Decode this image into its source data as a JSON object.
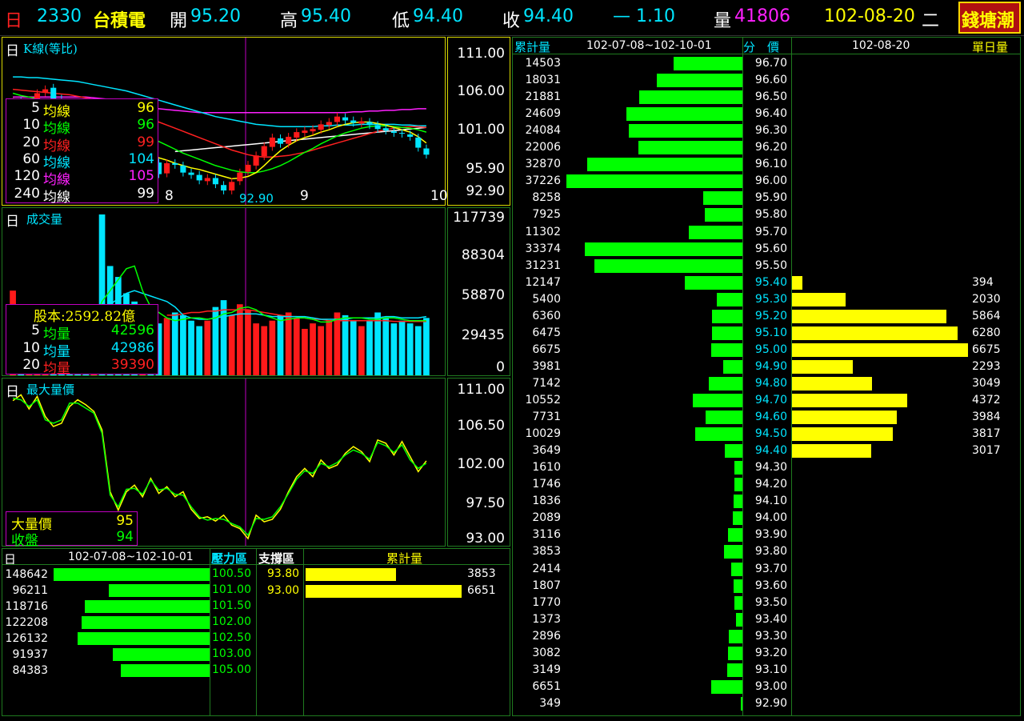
{
  "header": {
    "period": "日",
    "code": "2330",
    "name": "台積電",
    "open_label": "開",
    "open": "95.20",
    "high_label": "高",
    "high": "95.40",
    "low_label": "低",
    "low": "94.40",
    "close_label": "收",
    "close": "94.40",
    "change": "— 1.10",
    "volume_label": "量",
    "volume": "41806",
    "date": "102-08-20",
    "weekday": "二",
    "brand": "錢塘潮"
  },
  "kline": {
    "title_prefix": "日",
    "title": "K線(等比)",
    "axis": [
      "111.00",
      "106.00",
      "101.00",
      "95.90",
      "92.90"
    ],
    "month_labels": [
      "8",
      "9",
      "10"
    ],
    "low_marker": "92.90",
    "ma": [
      {
        "n": "5",
        "label": "均線",
        "value": "96",
        "color": "#ffff00"
      },
      {
        "n": "10",
        "label": "均線",
        "value": "96",
        "color": "#00ff00"
      },
      {
        "n": "20",
        "label": "均線",
        "value": "99",
        "color": "#ff2020"
      },
      {
        "n": "60",
        "label": "均線",
        "value": "104",
        "color": "#00e5ff"
      },
      {
        "n": "120",
        "label": "均線",
        "value": "105",
        "color": "#ff20ff"
      },
      {
        "n": "240",
        "label": "均線",
        "value": "99",
        "color": "#ffffff"
      }
    ]
  },
  "volume_panel": {
    "title_prefix": "日",
    "title": "成交量",
    "axis": [
      "117739",
      "88304",
      "58870",
      "29435",
      "0"
    ],
    "capital": "股本:2592.82億",
    "ma": [
      {
        "n": "5",
        "label": "均量",
        "value": "42596",
        "color": "#00ff00"
      },
      {
        "n": "10",
        "label": "均量",
        "value": "42986",
        "color": "#00e5ff"
      },
      {
        "n": "20",
        "label": "均量",
        "value": "39390",
        "color": "#ff2020"
      }
    ]
  },
  "maxvol_panel": {
    "title_prefix": "日",
    "title": "最大量價",
    "axis": [
      "111.00",
      "106.50",
      "102.00",
      "97.50",
      "93.00"
    ],
    "legend": [
      {
        "label": "大量價",
        "value": "95",
        "color": "#ffff00"
      },
      {
        "label": "收盤",
        "value": "94",
        "color": "#00ff00"
      }
    ]
  },
  "pressure": {
    "title_prefix": "日",
    "range": "102-07-08~102-10-01",
    "pressure_label": "壓力區",
    "support_label": "支撐區",
    "cum_label": "累計量",
    "rows": [
      {
        "vol": "148642",
        "price": "100.50"
      },
      {
        "vol": "96211",
        "price": "101.00"
      },
      {
        "vol": "118716",
        "price": "101.50"
      },
      {
        "vol": "122208",
        "price": "102.00"
      },
      {
        "vol": "126132",
        "price": "102.50"
      },
      {
        "vol": "91937",
        "price": "103.00"
      },
      {
        "vol": "84383",
        "price": "105.00"
      }
    ],
    "support": [
      {
        "price": "93.80",
        "vol": "3853"
      },
      {
        "price": "93.00",
        "vol": "6651"
      }
    ]
  },
  "distribution": {
    "cum_label": "累計量",
    "range": "102-07-08~102-10-01",
    "price_label": "分　價",
    "date": "102-08-20",
    "day_label": "單日量",
    "rows": [
      {
        "cum": "14503",
        "price": "96.70",
        "day": ""
      },
      {
        "cum": "18031",
        "price": "96.60",
        "day": ""
      },
      {
        "cum": "21881",
        "price": "96.50",
        "day": ""
      },
      {
        "cum": "24609",
        "price": "96.40",
        "day": ""
      },
      {
        "cum": "24084",
        "price": "96.30",
        "day": ""
      },
      {
        "cum": "22006",
        "price": "96.20",
        "day": ""
      },
      {
        "cum": "32870",
        "price": "96.10",
        "day": ""
      },
      {
        "cum": "37226",
        "price": "96.00",
        "day": ""
      },
      {
        "cum": "8258",
        "price": "95.90",
        "day": ""
      },
      {
        "cum": "7925",
        "price": "95.80",
        "day": ""
      },
      {
        "cum": "11302",
        "price": "95.70",
        "day": ""
      },
      {
        "cum": "33374",
        "price": "95.60",
        "day": ""
      },
      {
        "cum": "31231",
        "price": "95.50",
        "day": ""
      },
      {
        "cum": "12147",
        "price": "95.40",
        "day": "394"
      },
      {
        "cum": "5400",
        "price": "95.30",
        "day": "2030"
      },
      {
        "cum": "6360",
        "price": "95.20",
        "day": "5864"
      },
      {
        "cum": "6475",
        "price": "95.10",
        "day": "6280"
      },
      {
        "cum": "6675",
        "price": "95.00",
        "day": "6675"
      },
      {
        "cum": "3981",
        "price": "94.90",
        "day": "2293"
      },
      {
        "cum": "7142",
        "price": "94.80",
        "day": "3049"
      },
      {
        "cum": "10552",
        "price": "94.70",
        "day": "4372"
      },
      {
        "cum": "7731",
        "price": "94.60",
        "day": "3984"
      },
      {
        "cum": "10029",
        "price": "94.50",
        "day": "3817"
      },
      {
        "cum": "3649",
        "price": "94.40",
        "day": "3017"
      },
      {
        "cum": "1610",
        "price": "94.30",
        "day": ""
      },
      {
        "cum": "1746",
        "price": "94.20",
        "day": ""
      },
      {
        "cum": "1836",
        "price": "94.10",
        "day": ""
      },
      {
        "cum": "2089",
        "price": "94.00",
        "day": ""
      },
      {
        "cum": "3116",
        "price": "93.90",
        "day": ""
      },
      {
        "cum": "3853",
        "price": "93.80",
        "day": ""
      },
      {
        "cum": "2414",
        "price": "93.70",
        "day": ""
      },
      {
        "cum": "1807",
        "price": "93.60",
        "day": ""
      },
      {
        "cum": "1770",
        "price": "93.50",
        "day": ""
      },
      {
        "cum": "1373",
        "price": "93.40",
        "day": ""
      },
      {
        "cum": "2896",
        "price": "93.30",
        "day": ""
      },
      {
        "cum": "3082",
        "price": "93.20",
        "day": ""
      },
      {
        "cum": "3149",
        "price": "93.10",
        "day": ""
      },
      {
        "cum": "6651",
        "price": "93.00",
        "day": ""
      },
      {
        "cum": "349",
        "price": "92.90",
        "day": ""
      }
    ]
  },
  "colors": {
    "up": "#ff1a1a",
    "down": "#00e5ff",
    "bar_green": "#00ff00",
    "bar_yellow": "#ffff00",
    "grid": "#1f7a1f"
  },
  "kline_series": {
    "open": [
      103.0,
      104.5,
      103.8,
      104.2,
      105.6,
      106.2,
      104.8,
      103.6,
      102.5,
      101.0,
      100.2,
      100.8,
      99.6,
      98.6,
      97.9,
      97.2,
      96.7,
      97.2,
      96.6,
      95.2,
      96.5,
      96.2,
      95.3,
      95.0,
      94.2,
      94.6,
      93.7,
      93.0,
      94.2,
      95.4,
      96.2,
      97.4,
      98.6,
      99.7,
      99.0,
      99.8,
      100.4,
      100.6,
      100.8,
      101.4,
      101.8,
      102.4,
      102.0,
      101.6,
      101.8,
      101.4,
      101.0,
      100.6,
      100.4,
      100.2,
      99.8,
      98.4
    ],
    "close": [
      104.3,
      103.7,
      104.3,
      105.5,
      106.0,
      104.7,
      103.7,
      102.6,
      101.1,
      100.0,
      100.9,
      99.7,
      98.5,
      98.0,
      97.1,
      96.8,
      97.3,
      96.5,
      95.1,
      96.5,
      96.3,
      95.3,
      95.0,
      94.3,
      94.6,
      93.8,
      93.0,
      94.1,
      95.3,
      96.3,
      97.5,
      98.7,
      99.8,
      99.0,
      99.9,
      100.5,
      100.7,
      100.9,
      101.5,
      101.8,
      102.5,
      102.0,
      101.7,
      101.9,
      101.4,
      100.9,
      100.7,
      100.4,
      100.3,
      99.9,
      98.5,
      97.6
    ],
    "ma5": [
      104.8,
      104.6,
      104.4,
      104.4,
      104.5,
      104.6,
      104.6,
      104.4,
      104.0,
      103.3,
      102.5,
      101.6,
      100.8,
      100.1,
      99.4,
      98.7,
      98.1,
      97.7,
      97.2,
      96.9,
      96.5,
      96.2,
      95.9,
      95.7,
      95.4,
      95.1,
      94.8,
      94.5,
      94.6,
      94.8,
      95.3,
      96.2,
      97.2,
      98.1,
      98.8,
      99.4,
      99.8,
      100.1,
      100.5,
      100.8,
      101.2,
      101.5,
      101.7,
      101.8,
      101.8,
      101.6,
      101.4,
      101.1,
      100.8,
      100.5,
      99.9,
      99.1
    ],
    "ma10": [
      105.5,
      105.2,
      105.0,
      104.8,
      104.7,
      104.6,
      104.5,
      104.3,
      104.1,
      103.8,
      103.5,
      103.1,
      102.6,
      102.1,
      101.5,
      100.9,
      100.3,
      99.8,
      99.3,
      98.8,
      98.3,
      97.8,
      97.4,
      97.0,
      96.6,
      96.2,
      95.9,
      95.6,
      95.4,
      95.3,
      95.3,
      95.5,
      95.8,
      96.2,
      96.7,
      97.3,
      97.9,
      98.4,
      99.0,
      99.5,
      100.0,
      100.4,
      100.7,
      101.0,
      101.2,
      101.3,
      101.3,
      101.2,
      101.1,
      101.0,
      100.8,
      100.5
    ],
    "ma20": [
      106.0,
      105.9,
      105.8,
      105.7,
      105.6,
      105.5,
      105.4,
      105.3,
      105.1,
      104.9,
      104.7,
      104.4,
      104.1,
      103.8,
      103.4,
      103.0,
      102.6,
      102.2,
      101.8,
      101.4,
      101.0,
      100.6,
      100.2,
      99.8,
      99.4,
      99.0,
      98.6,
      98.2,
      97.9,
      97.6,
      97.4,
      97.3,
      97.3,
      97.4,
      97.5,
      97.7,
      97.9,
      98.2,
      98.5,
      98.8,
      99.1,
      99.4,
      99.7,
      100.0,
      100.3,
      100.6,
      100.8,
      101.0,
      101.1,
      101.2,
      101.2,
      101.1
    ],
    "ma60": [
      107.6,
      107.6,
      107.5,
      107.5,
      107.4,
      107.3,
      107.2,
      107.1,
      107.0,
      106.8,
      106.6,
      106.4,
      106.2,
      106.0,
      105.8,
      105.5,
      105.2,
      104.9,
      104.6,
      104.3,
      104.0,
      103.7,
      103.4,
      103.1,
      102.8,
      102.5,
      102.3,
      102.1,
      101.9,
      101.7,
      101.5,
      101.4,
      101.3,
      101.2,
      101.2,
      101.2,
      101.2,
      101.2,
      101.3,
      101.3,
      101.4,
      101.4,
      101.4,
      101.5,
      101.5,
      101.5,
      101.5,
      101.5,
      101.4,
      101.4,
      101.3,
      101.3
    ],
    "ma120": [
      105.0,
      105.0,
      105.0,
      105.0,
      105.0,
      105.0,
      105.0,
      105.0,
      105.0,
      105.0,
      104.9,
      104.8,
      104.7,
      104.5,
      104.3,
      104.1,
      103.9,
      103.7,
      103.5,
      103.4,
      103.3,
      103.2,
      103.1,
      103.0,
      103.0,
      103.0,
      103.0,
      103.0,
      103.0,
      103.0,
      103.0,
      103.0,
      103.0,
      103.0,
      103.0,
      103.0,
      103.0,
      103.0,
      103.0,
      103.0,
      103.0,
      103.0,
      103.1,
      103.1,
      103.2,
      103.2,
      103.3,
      103.3,
      103.4,
      103.4,
      103.5,
      103.5
    ],
    "ma240": [
      null,
      null,
      null,
      null,
      null,
      null,
      null,
      null,
      null,
      null,
      null,
      null,
      null,
      null,
      null,
      null,
      null,
      null,
      null,
      null,
      98.0,
      98.1,
      98.2,
      98.3,
      98.4,
      98.5,
      98.6,
      98.7,
      98.8,
      98.9,
      99.0,
      99.1,
      99.2,
      99.3,
      99.4,
      99.5,
      99.6,
      99.7,
      99.8,
      99.9,
      100.0,
      100.1,
      100.2,
      100.3,
      100.4,
      100.5,
      100.6,
      100.7,
      100.8,
      100.9,
      101.0,
      101.1
    ]
  },
  "volume_series": {
    "values": [
      62000,
      40000,
      30000,
      31000,
      34000,
      36000,
      28000,
      32000,
      42000,
      48000,
      30000,
      117739,
      80000,
      72000,
      60000,
      54000,
      30000,
      34000,
      38000,
      42000,
      46000,
      44000,
      40000,
      36000,
      40000,
      50000,
      55000,
      44000,
      52000,
      48000,
      38000,
      36000,
      40000,
      44000,
      46000,
      42000,
      34000,
      38000,
      36000,
      40000,
      46000,
      44000,
      40000,
      36000,
      40000,
      46000,
      42000,
      38000,
      40000,
      38000,
      36000,
      42000
    ],
    "ma5": [
      50000,
      46000,
      40000,
      37000,
      35000,
      34000,
      33000,
      34000,
      36000,
      38000,
      38000,
      54000,
      62000,
      70000,
      78000,
      80000,
      62000,
      50000,
      46000,
      42000,
      40000,
      41000,
      42000,
      42000,
      41000,
      42000,
      45000,
      46000,
      49000,
      50000,
      48000,
      44000,
      42000,
      40000,
      41000,
      42000,
      42000,
      41000,
      39000,
      39000,
      41000,
      42000,
      42000,
      42000,
      41000,
      41000,
      42000,
      42000,
      41000,
      40000,
      40000,
      40000
    ],
    "ma10": [
      null,
      null,
      null,
      null,
      null,
      null,
      null,
      null,
      null,
      40000,
      40000,
      47000,
      52000,
      56000,
      60000,
      62000,
      60000,
      58000,
      56000,
      54000,
      50000,
      44000,
      42000,
      41000,
      41000,
      42000,
      43000,
      44000,
      45000,
      45000,
      45000,
      44000,
      43000,
      43000,
      43000,
      43000,
      43000,
      42000,
      41000,
      41000,
      41000,
      41000,
      42000,
      42000,
      42000,
      42000,
      43000,
      43000,
      42000,
      42000,
      42000,
      43000
    ],
    "ma20": [
      null,
      null,
      null,
      null,
      null,
      null,
      null,
      null,
      null,
      null,
      null,
      null,
      null,
      null,
      null,
      null,
      null,
      null,
      null,
      44000,
      44000,
      45000,
      46000,
      46000,
      47000,
      47000,
      48000,
      48000,
      48000,
      48000,
      47000,
      46000,
      45000,
      44000,
      43000,
      43000,
      42000,
      41000,
      41000,
      40000,
      40000,
      40000,
      40000,
      40000,
      40000,
      40000,
      40000,
      39500,
      39500,
      39400,
      39400,
      39390
    ]
  },
  "maxvol_series": {
    "maxvol": [
      109.5,
      110.2,
      108.5,
      110.0,
      107.6,
      106.4,
      106.8,
      108.8,
      109.6,
      109.0,
      108.2,
      106.0,
      98.6,
      96.4,
      98.6,
      99.4,
      98.0,
      100.2,
      98.4,
      99.2,
      98.0,
      98.6,
      96.5,
      95.4,
      95.6,
      95.1,
      95.8,
      94.6,
      94.2,
      93.0,
      95.8,
      95.0,
      95.3,
      96.5,
      98.6,
      100.4,
      101.4,
      100.4,
      102.4,
      101.4,
      101.8,
      103.2,
      104.0,
      103.4,
      102.2,
      104.8,
      104.4,
      103.0,
      104.6,
      102.8,
      101.0,
      102.3
    ],
    "close": [
      109.8,
      109.6,
      108.8,
      109.6,
      107.2,
      106.8,
      107.2,
      109.2,
      109.2,
      108.6,
      108.0,
      105.6,
      98.2,
      96.8,
      98.9,
      99.0,
      98.3,
      100.0,
      98.8,
      99.0,
      98.3,
      98.2,
      96.8,
      95.6,
      95.2,
      95.4,
      95.3,
      94.8,
      94.4,
      93.4,
      95.4,
      95.3,
      95.6,
      96.8,
      98.4,
      100.1,
      101.1,
      100.8,
      102.0,
      101.6,
      102.1,
      103.0,
      103.6,
      103.2,
      102.5,
      104.5,
      104.1,
      103.3,
      104.2,
      102.4,
      101.4,
      102.0
    ]
  }
}
